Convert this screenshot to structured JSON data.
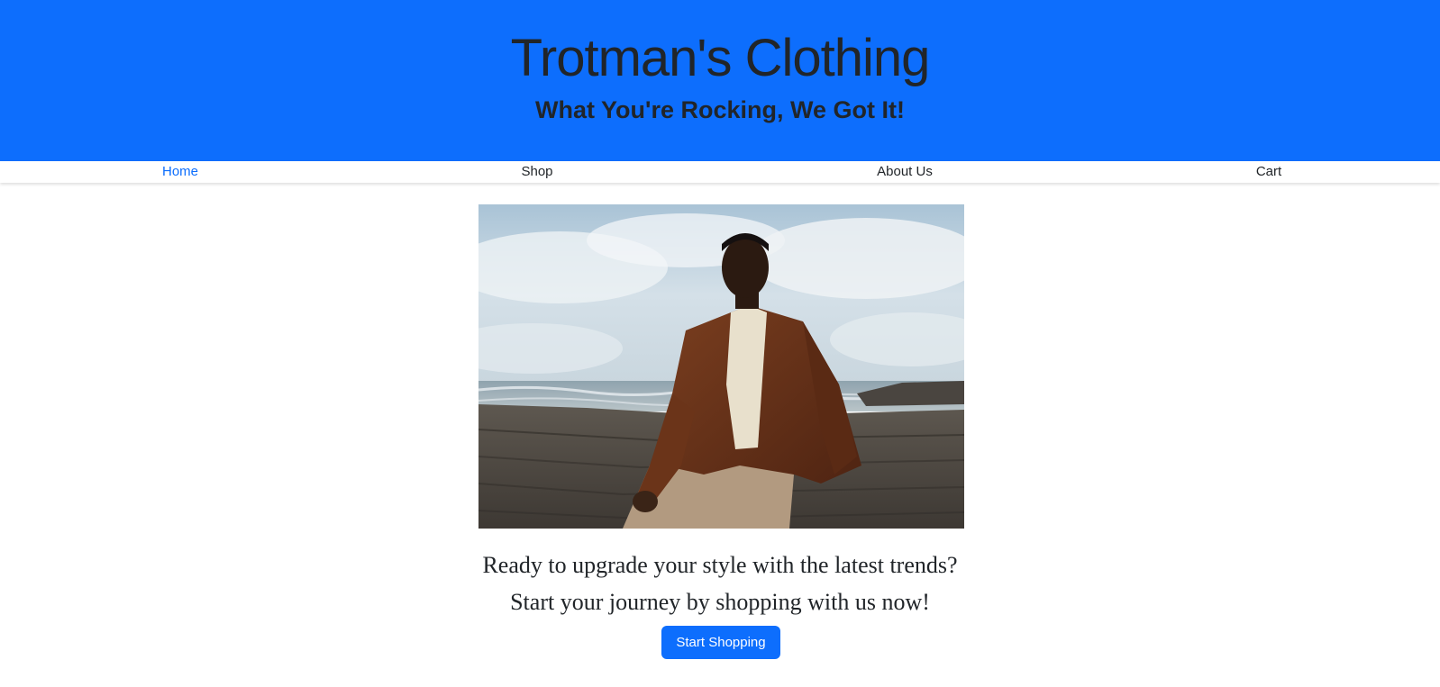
{
  "header": {
    "title": "Trotman's Clothing",
    "tagline": "What You're Rocking, We Got It!"
  },
  "nav": {
    "items": [
      {
        "label": "Home",
        "active": true
      },
      {
        "label": "Shop",
        "active": false
      },
      {
        "label": "About Us",
        "active": false
      },
      {
        "label": "Cart",
        "active": false
      }
    ]
  },
  "hero": {
    "image_subject": "man in brown jacket seated on coastal rocks"
  },
  "cta": {
    "line1": "Ready to upgrade your style with the latest trends?",
    "line2": "Start your journey by shopping with us now!",
    "button_label": "Start Shopping"
  },
  "colors": {
    "brand_blue": "#0d6efd",
    "text_dark": "#212529",
    "background": "#ffffff"
  }
}
